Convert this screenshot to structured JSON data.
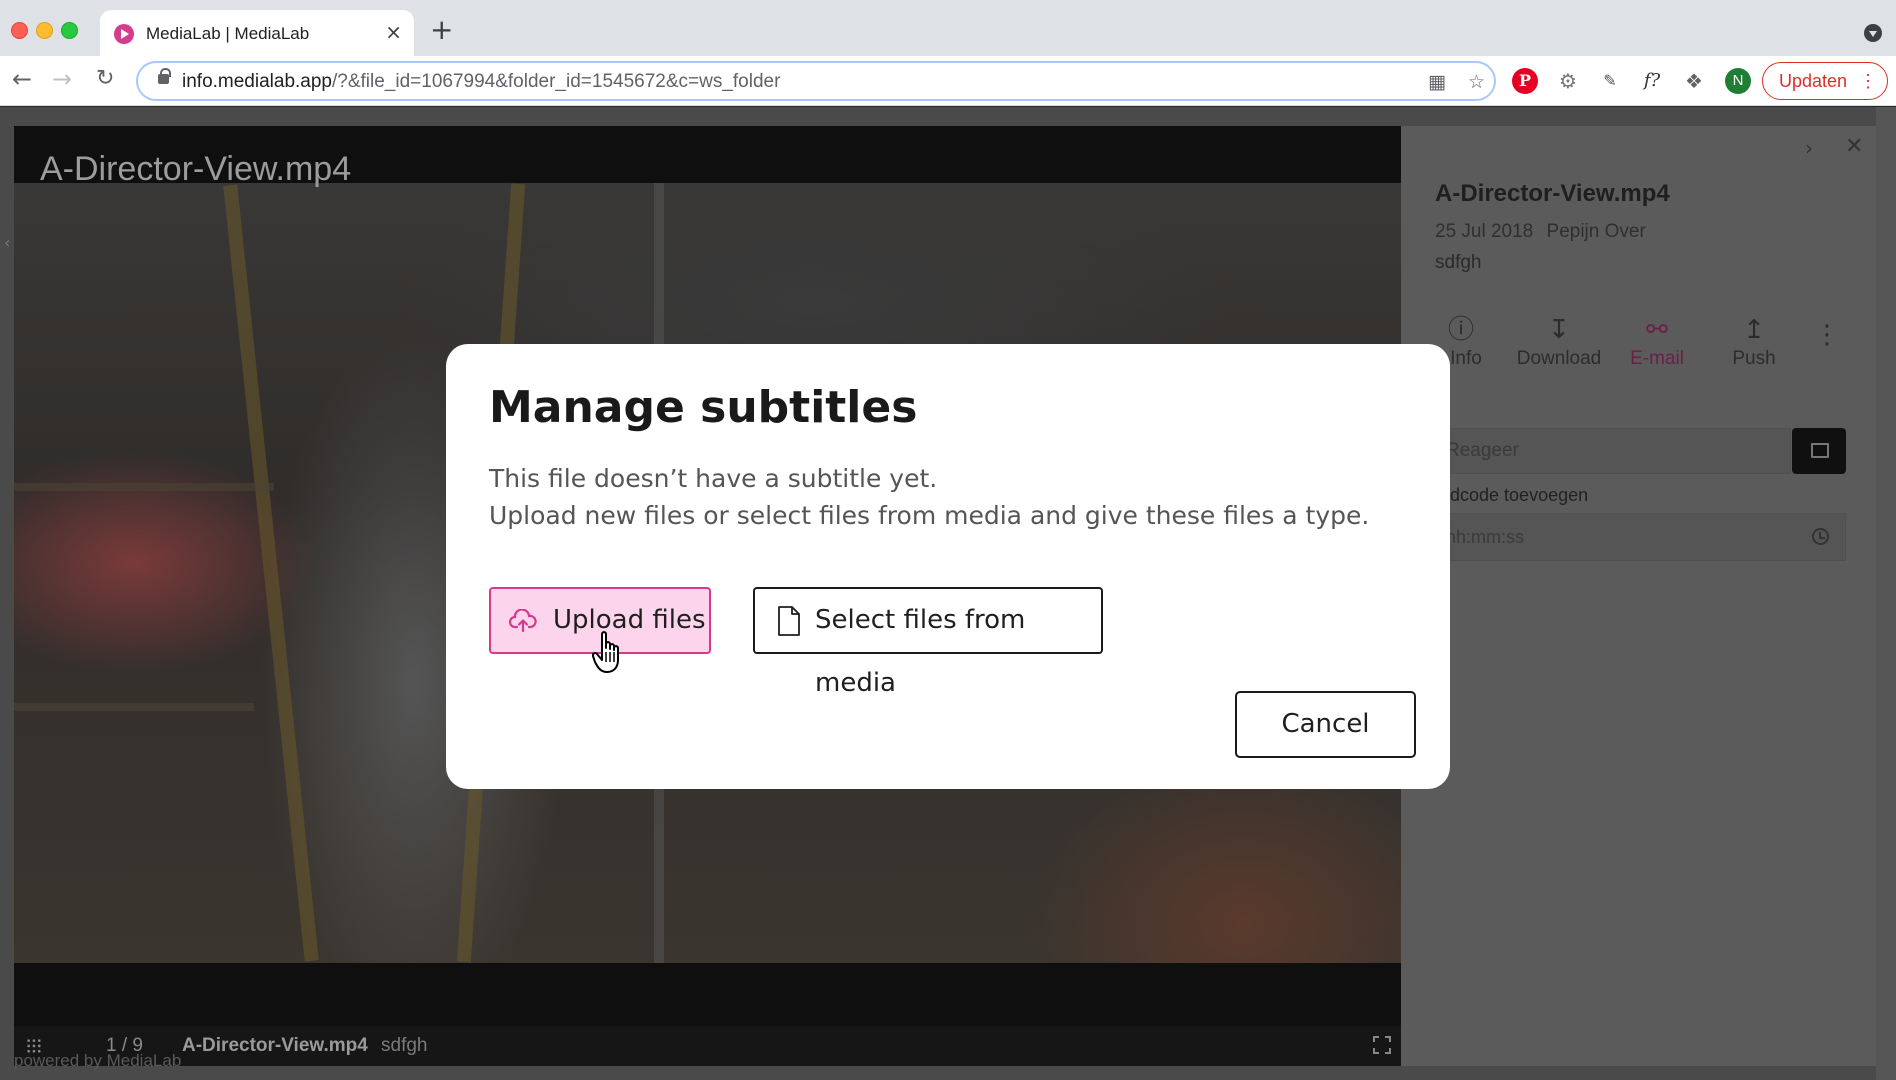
{
  "browser": {
    "tab_title": "MediaLab | MediaLab",
    "tab_close": "×",
    "new_tab": "+",
    "url_host": "info.medialab.app",
    "url_rest": "/?&file_id=1067994&folder_id=1545672&c=ws_folder",
    "profile_initial": "N",
    "update_label": "Updaten",
    "extensions": [
      "pinterest-icon",
      "gear-icon",
      "color-picker-icon",
      "font-identifier-icon",
      "puzzle-icon"
    ]
  },
  "viewer": {
    "overlay_title": "A-Director-View.mp4",
    "counter": "1 / 9",
    "filename": "A-Director-View.mp4",
    "description": "sdfgh"
  },
  "panel": {
    "title": "A-Director-View.mp4",
    "date": "25 Jul 2018",
    "author": "Pepijn Over",
    "description": "sdfgh",
    "actions": [
      {
        "label": "Info",
        "icon": "info-icon"
      },
      {
        "label": "Download",
        "icon": "download-icon"
      },
      {
        "label": "E-mail",
        "icon": "share-icon",
        "active": true
      },
      {
        "label": "Push",
        "icon": "upload-icon"
      }
    ],
    "comment_placeholder": "Reageer",
    "timecode_label": "tijdcode toevoegen",
    "timecode_placeholder": "hh:mm:ss"
  },
  "footer": {
    "powered_by": "powered by MediaLab"
  },
  "modal": {
    "title": "Manage subtitles",
    "line1": "This file doesn’t have a subtitle yet.",
    "line2": "Upload new files or select files from media and give these files a type.",
    "upload_label": "Upload files",
    "select_label": "Select files from media",
    "cancel_label": "Cancel"
  },
  "colors": {
    "accent": "#d7398e",
    "accent_bg": "#fcd4ec",
    "update_red": "#d93025"
  }
}
